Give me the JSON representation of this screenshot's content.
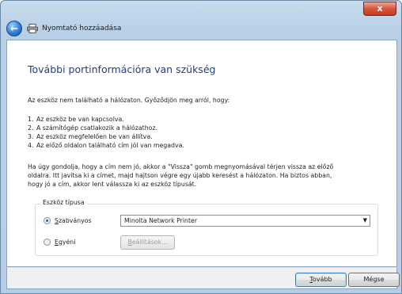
{
  "window": {
    "title": "Nyomtató hozzáadása",
    "close_label": "x"
  },
  "page": {
    "heading": "További portinformációra van szükség",
    "intro": "Az eszköz nem található a hálózaton. Győződjön meg arról, hogy:",
    "checklist": [
      {
        "num": "1.",
        "text": "Az eszköz be van kapcsolva."
      },
      {
        "num": "2.",
        "text": "A számítógép csatlakozik a hálózathoz."
      },
      {
        "num": "3.",
        "text": "Az eszköz megfelelően be van állítva."
      },
      {
        "num": "4.",
        "text": "Az előző oldalon található cím jól van megadva."
      }
    ],
    "paragraph_lines": [
      "Ha úgy gondolja, hogy a cím nem jó, akkor a \"Vissza\" gomb megnyomásával térjen vissza az előző",
      "oldalra. Itt javítsa ki a címet, majd hajtson végre egy újabb keresést a hálózaton. Ha biztos abban,",
      "hogy jó a cím, akkor lent válassza ki az eszköz típusát."
    ]
  },
  "device_type": {
    "group_title": "Eszköz típusa",
    "standard": {
      "label_u": "S",
      "label_rest": "zabványos",
      "selected": true
    },
    "custom": {
      "label_u": "E",
      "label_rest": "gyéni",
      "selected": false
    },
    "select_value": "Minolta Network Printer",
    "settings_u": "B",
    "settings_rest": "eállítások..."
  },
  "footer": {
    "next_u": "T",
    "next_rest": "ovább",
    "cancel_label": "Mégse"
  }
}
